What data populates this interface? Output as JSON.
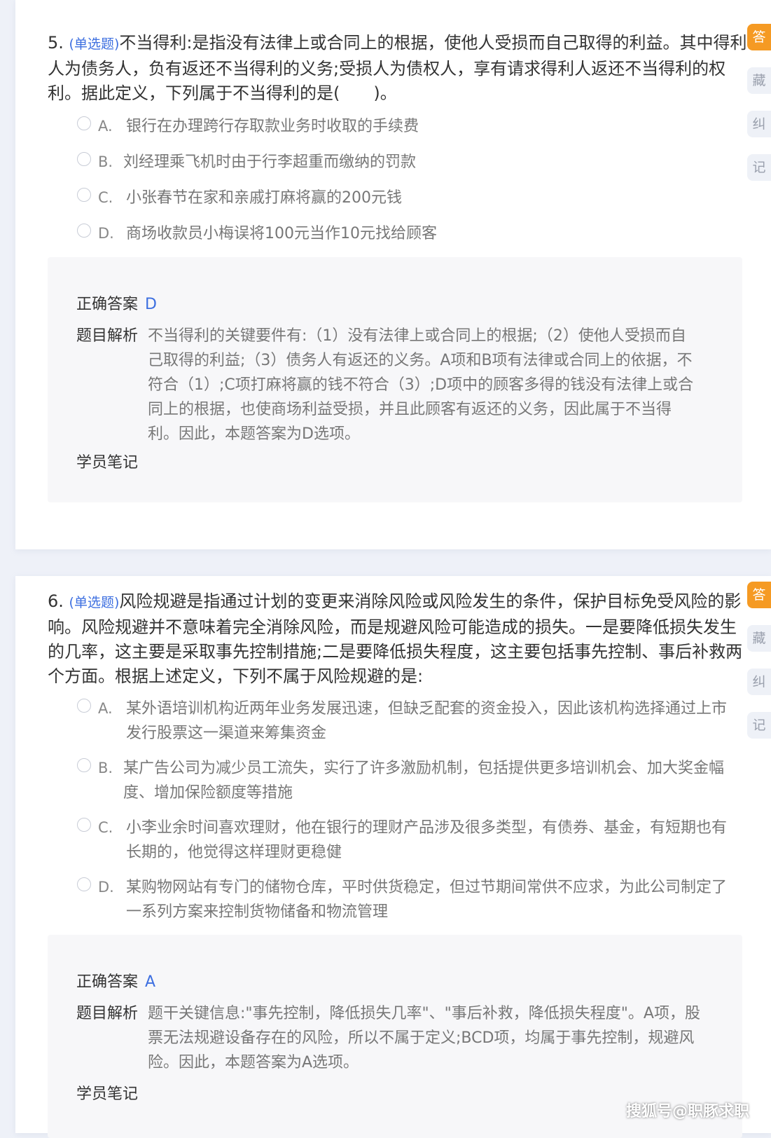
{
  "q5": {
    "number": "5.",
    "type": "(单选题)",
    "stem": "不当得利:是指没有法律上或合同上的根据，使他人受损而自己取得的利益。其中得利人为债务人，负有返还不当得利的义务;受损人为债权人，享有请求得利人返还不当得利的权利。据此定义，下列属于不当得利的是(　　)。",
    "options": [
      {
        "letter": "A.",
        "text": "银行在办理跨行存取款业务时收取的手续费"
      },
      {
        "letter": "B.",
        "text": "刘经理乘飞机时由于行李超重而缴纳的罚款"
      },
      {
        "letter": "C.",
        "text": "小张春节在家和亲戚打麻将赢的200元钱"
      },
      {
        "letter": "D.",
        "text": "商场收款员小梅误将100元当作10元找给顾客"
      }
    ],
    "answer_label": "正确答案",
    "answer": "D",
    "analysis_label": "题目解析",
    "analysis": "不当得利的关键要件有:（1）没有法律上或合同上的根据;（2）使他人受损而自己取得的利益;（3）债务人有返还的义务。A项和B项有法律或合同上的依据，不符合（1）;C项打麻将赢的钱不符合（3）;D项中的顾客多得的钱没有法律上或合同上的根据，也使商场利益受损，并且此顾客有返还的义务，因此属于不当得利。因此，本题答案为D选项。",
    "note_label": "学员笔记"
  },
  "q6": {
    "number": "6.",
    "type": "(单选题)",
    "stem": "风险规避是指通过计划的变更来消除风险或风险发生的条件，保护目标免受风险的影响。风险规避并不意味着完全消除风险，而是规避风险可能造成的损失。一是要降低损失发生的几率，这主要是采取事先控制措施;二是要降低损失程度，这主要包括事先控制、事后补救两个方面。根据上述定义，下列不属于风险规避的是:",
    "options": [
      {
        "letter": "A.",
        "text": "某外语培训机构近两年业务发展迅速，但缺乏配套的资金投入，因此该机构选择通过上市发行股票这一渠道来筹集资金"
      },
      {
        "letter": "B.",
        "text": "某广告公司为减少员工流失，实行了许多激励机制，包括提供更多培训机会、加大奖金幅度、增加保险额度等措施"
      },
      {
        "letter": "C.",
        "text": "小李业余时间喜欢理财，他在银行的理财产品涉及很多类型，有债券、基金，有短期也有长期的，他觉得这样理财更稳健"
      },
      {
        "letter": "D.",
        "text": "某购物网站有专门的储物仓库，平时供货稳定，但过节期间常供不应求，为此公司制定了一系列方案来控制货物储备和物流管理"
      }
    ],
    "answer_label": "正确答案",
    "answer": "A",
    "analysis_label": "题目解析",
    "analysis": "题干关键信息:\"事先控制，降低损失几率\"、\"事后补救，降低损失程度\"。A项，股票无法规避设备存在的风险，所以不属于定义;BCD项，均属于事先控制，规避风险。因此，本题答案为A选项。",
    "note_label": "学员笔记"
  },
  "side": {
    "answer": "答",
    "favorite": "藏",
    "correct": "纠",
    "note": "记"
  },
  "watermark": "搜狐号@职豚求职"
}
